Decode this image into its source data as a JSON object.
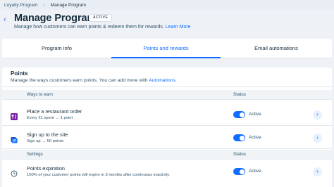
{
  "breadcrumb": {
    "parent": "Loyalty Program",
    "separator": "›",
    "current": "Manage Program"
  },
  "header": {
    "back_icon": "chevron-left-icon",
    "title": "Manage Program",
    "badge": "ACTIVE",
    "subtitle": "Manage how customers can earn points & redeem them for rewards.",
    "learn_more": "Learn More"
  },
  "tabs": [
    {
      "label": "Program info",
      "active": false
    },
    {
      "label": "Points and rewards",
      "active": true
    },
    {
      "label": "Email automations",
      "active": false
    }
  ],
  "points_card": {
    "title": "Points",
    "description": "Manage the ways customers earn points. You can add more with",
    "automations_link": "Automations",
    "period": "."
  },
  "ways_table": {
    "col_ways": "Ways to earn",
    "col_status": "Status",
    "rows": [
      {
        "title": "Place a restaurant order",
        "subtitle": "Every €1 spent → 1 point",
        "icon": "restaurant-icon",
        "status": "Active",
        "enabled": true
      },
      {
        "title": "Sign up to the site",
        "subtitle": "Sign up → 50 points",
        "icon": "signup-icon",
        "status": "Active",
        "enabled": true
      }
    ]
  },
  "settings_table": {
    "col_settings": "Settings",
    "col_status": "Status",
    "rows": [
      {
        "title": "Points expiration",
        "subtitle": "100% of your customer points will expire in 3 months after continuous inactivity.",
        "icon": "clock-icon",
        "status": "Active",
        "enabled": true
      }
    ]
  },
  "chevron_icon": "chevron-right-icon",
  "colors": {
    "accent": "#116dff",
    "page_bg": "#eef2f7",
    "text": "#162d3d",
    "restaurant_icon": "#7b1fa2"
  }
}
